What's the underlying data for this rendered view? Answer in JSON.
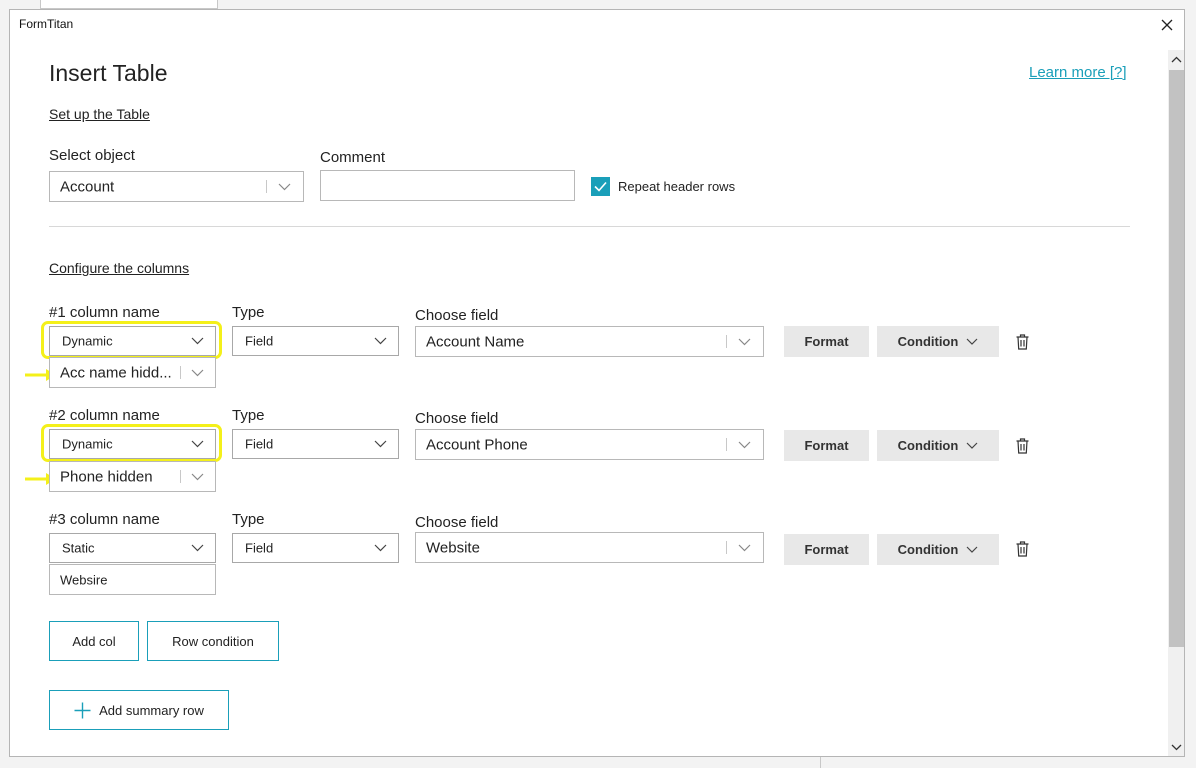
{
  "window": {
    "app_title": "FormTitan"
  },
  "header": {
    "title": "Insert Table",
    "learn_more": "Learn more [?]"
  },
  "setup": {
    "section_link": "Set up the Table",
    "select_object_label": "Select object",
    "select_object_value": "Account",
    "comment_label": "Comment",
    "comment_value": "",
    "repeat_header_label": "Repeat header rows",
    "repeat_header_checked": true
  },
  "columns_section": {
    "link": "Configure the columns"
  },
  "columns": [
    {
      "name_label": "#1 column name",
      "name_mode": "Dynamic",
      "name_value": "Acc name hidd...",
      "type_label": "Type",
      "type_value": "Field",
      "field_label": "Choose field",
      "field_value": "Account Name",
      "format_label": "Format",
      "condition_label": "Condition"
    },
    {
      "name_label": "#2 column name",
      "name_mode": "Dynamic",
      "name_value": "Phone hidden",
      "type_label": "Type",
      "type_value": "Field",
      "field_label": "Choose field",
      "field_value": "Account Phone",
      "format_label": "Format",
      "condition_label": "Condition"
    },
    {
      "name_label": "#3 column name",
      "name_mode": "Static",
      "name_value": "Websire",
      "type_label": "Type",
      "type_value": "Field",
      "field_label": "Choose field",
      "field_value": "Website",
      "format_label": "Format",
      "condition_label": "Condition"
    }
  ],
  "actions": {
    "add_col": "Add col",
    "row_condition": "Row condition",
    "add_summary_row": "Add summary row"
  },
  "colors": {
    "accent": "#1a9fb9",
    "highlight": "#f4f01a",
    "arrow": "#f4f01a"
  },
  "icons": {
    "close": "close-icon",
    "chevron": "chevron-down-icon",
    "trash": "trash-icon",
    "check": "checkmark-icon",
    "plus": "plus-icon",
    "pointer": "arrow-right-icon"
  }
}
